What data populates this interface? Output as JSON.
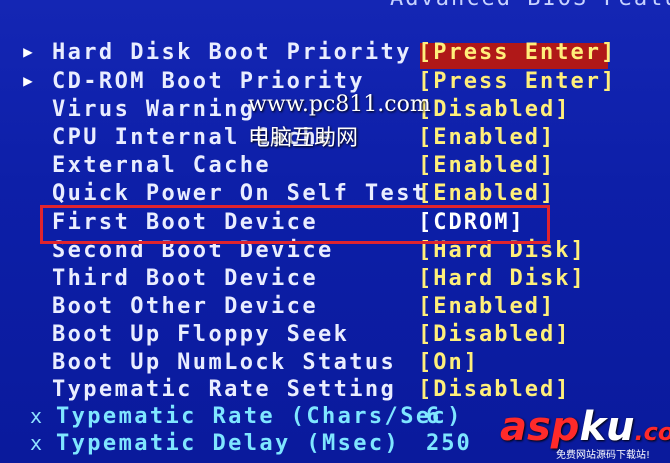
{
  "header": {
    "title": "Advanced BIOS Featu"
  },
  "settings": [
    {
      "marker": "▶",
      "label": "Hard Disk Boot Priority",
      "value": "[Press Enter]"
    },
    {
      "marker": "▶",
      "label": "CD-ROM Boot Priority",
      "value": "[Press Enter]"
    },
    {
      "marker": "",
      "label": "Virus Warning",
      "value": "[Disabled]"
    },
    {
      "marker": "",
      "label": "CPU Internal Cache",
      "value": "[Enabled]"
    },
    {
      "marker": "",
      "label": "External Cache",
      "value": "[Enabled]"
    },
    {
      "marker": "",
      "label": "Quick Power On Self Test",
      "value": "[Enabled]"
    },
    {
      "marker": "",
      "label": "First Boot Device",
      "value": "[CDROM]"
    },
    {
      "marker": "",
      "label": "Second Boot Device",
      "value": "[Hard Disk]"
    },
    {
      "marker": "",
      "label": "Third Boot Device",
      "value": "[Hard Disk]"
    },
    {
      "marker": "",
      "label": "Boot Other Device",
      "value": "[Enabled]"
    },
    {
      "marker": "",
      "label": "Boot Up Floppy Seek",
      "value": "[Disabled]"
    },
    {
      "marker": "",
      "label": "Boot Up NumLock Status",
      "value": "[On]"
    },
    {
      "marker": "",
      "label": "Typematic Rate Setting",
      "value": "[Disabled]"
    },
    {
      "marker": "x",
      "label": "Typematic Rate (Chars/Sec)",
      "value": "6"
    },
    {
      "marker": "x",
      "label": "Typematic Delay (Msec)",
      "value": "250"
    }
  ],
  "watermark": {
    "url": "www.pc811.com",
    "cn": "电脑互助网"
  },
  "logo": {
    "part1": "asp",
    "part2": "ku",
    "part3": ".com",
    "sub": "免费网站源码下载站!"
  },
  "colors": {
    "background": "#0d1fa8",
    "label": "#e9edff",
    "value_active": "#ffef7a",
    "disabled_item": "#7fe6ff",
    "selection_border": "#e0242e"
  }
}
